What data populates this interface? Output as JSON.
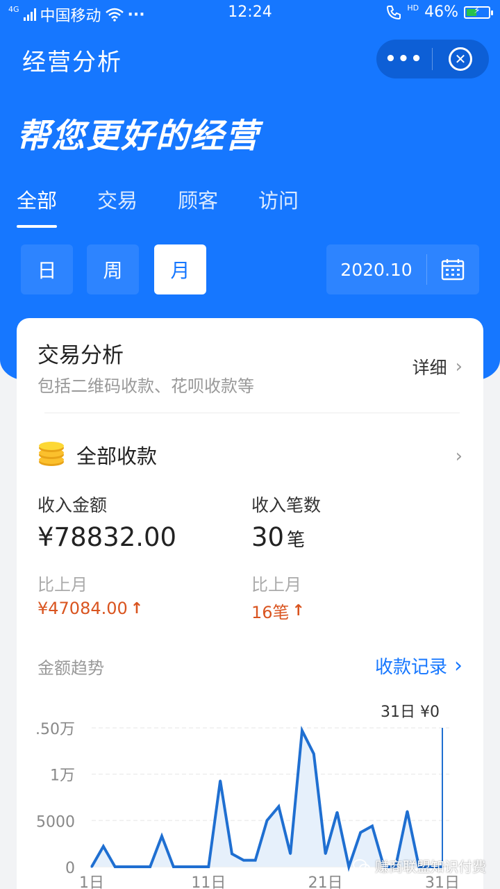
{
  "status_bar": {
    "network": "4G",
    "carrier": "中国移动",
    "more": "···",
    "time": "12:24",
    "hd": "HD",
    "battery": "46%",
    "battery_level": 0.46
  },
  "nav": {
    "title": "经营分析"
  },
  "slogan": "帮您更好的经营",
  "tabs": [
    {
      "label": "全部",
      "active": true
    },
    {
      "label": "交易",
      "active": false
    },
    {
      "label": "顾客",
      "active": false
    },
    {
      "label": "访问",
      "active": false
    }
  ],
  "periods": [
    {
      "label": "日",
      "active": false
    },
    {
      "label": "周",
      "active": false
    },
    {
      "label": "月",
      "active": true
    }
  ],
  "date": "2020.10",
  "card": {
    "title": "交易分析",
    "subtitle": "包括二维码收款、花呗收款等",
    "detail": "详细",
    "all_payments": "全部收款",
    "income_amount_label": "收入金额",
    "income_amount": "¥78832.00",
    "income_count_label": "收入笔数",
    "income_count": "30",
    "count_unit": "笔",
    "compare_label": "比上月",
    "amount_change": "¥47084.00",
    "count_change": "16笔",
    "trend_label": "金额趋势",
    "records_link": "收款记录"
  },
  "colors": {
    "primary": "#1677ff",
    "up": "#d9541f",
    "line": "#1f6fd1"
  },
  "chart_data": {
    "type": "line",
    "x": [
      1,
      2,
      3,
      4,
      5,
      6,
      7,
      8,
      9,
      10,
      11,
      12,
      13,
      14,
      15,
      16,
      17,
      18,
      19,
      20,
      21,
      22,
      23,
      24,
      25,
      26,
      27,
      28,
      29,
      30,
      31
    ],
    "values": [
      0,
      2200,
      0,
      0,
      0,
      0,
      3300,
      0,
      0,
      0,
      0,
      9300,
      1400,
      700,
      700,
      5000,
      6500,
      1400,
      14700,
      12200,
      1400,
      5900,
      0,
      3700,
      4400,
      0,
      0,
      6000,
      0,
      0,
      0
    ],
    "y_ticks": [
      0,
      5000,
      10000,
      15000
    ],
    "y_tick_labels": [
      "0",
      "5000",
      "1万",
      ".50万"
    ],
    "x_tick_labels": [
      "1日",
      "11日",
      "21日",
      "31日"
    ],
    "x_tick_positions": [
      1,
      11,
      21,
      31
    ],
    "ylim": [
      0,
      15000
    ],
    "tooltip": "31日 ¥0",
    "tooltip_x": 31,
    "grid": true
  },
  "watermark": "赚商联盟知识付费"
}
